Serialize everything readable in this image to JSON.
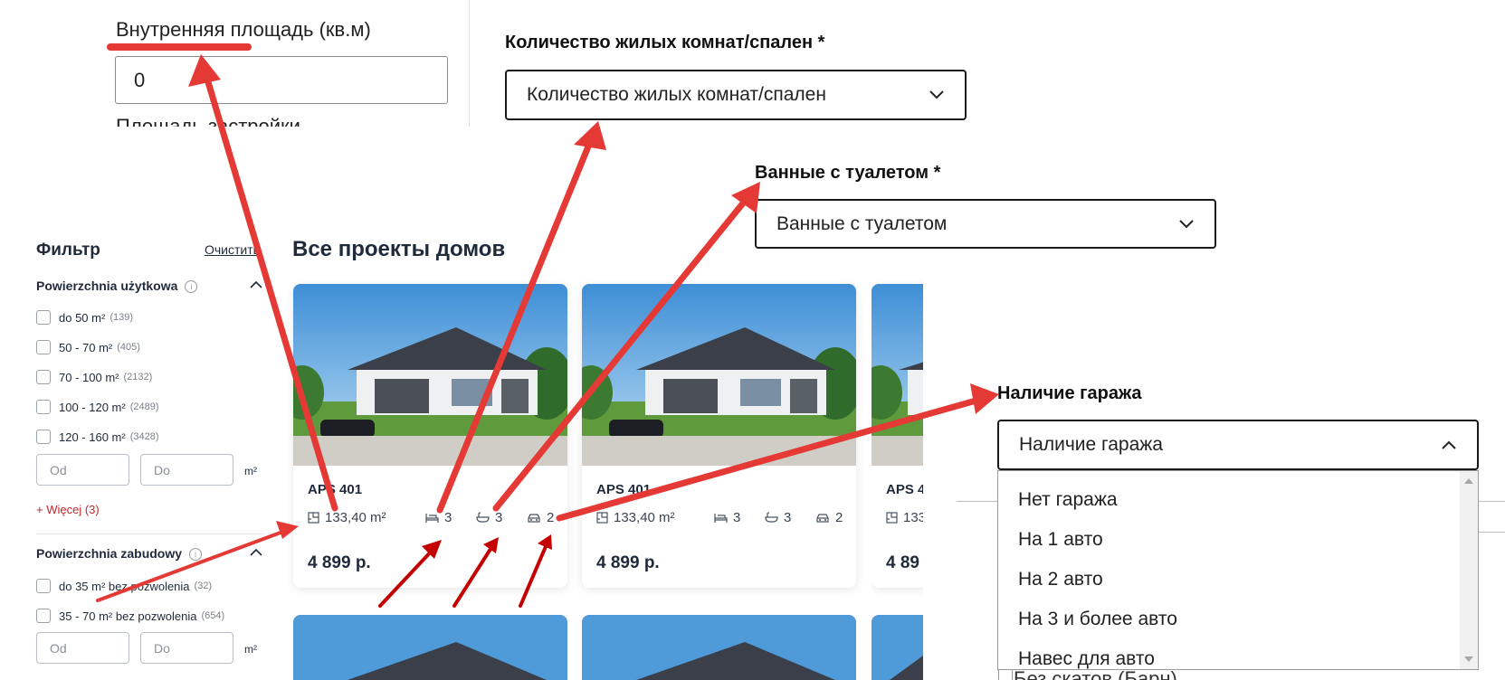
{
  "area_field": {
    "label": "Внутренняя площадь (кв.м)",
    "value": "0",
    "next_label_partial": "Площадь застройки"
  },
  "rooms": {
    "title": "Количество жилых комнат/спален *",
    "placeholder": "Количество жилых комнат/спален"
  },
  "bathrooms": {
    "title": "Ванные с туалетом *",
    "placeholder": "Ванные с туалетом"
  },
  "filter": {
    "title": "Фильтр",
    "clear": "Очистить",
    "usable_area": {
      "title": "Powierzchnia użytkowa",
      "options": [
        {
          "label": "do 50 m²",
          "count": "(139)"
        },
        {
          "label": "50 - 70 m²",
          "count": "(405)"
        },
        {
          "label": "70 - 100 m²",
          "count": "(2132)"
        },
        {
          "label": "100 - 120 m²",
          "count": "(2489)"
        },
        {
          "label": "120 - 160 m²",
          "count": "(3428)"
        }
      ],
      "from_placeholder": "Od",
      "to_placeholder": "Do",
      "unit": "m²",
      "more": "+ Więcej (3)"
    },
    "built_area": {
      "title": "Powierzchnia zabudowy",
      "options": [
        {
          "label": "do 35 m² bez pozwolenia",
          "count": "(32)"
        },
        {
          "label": "35 - 70 m² bez pozwolenia",
          "count": "(654)"
        }
      ],
      "from_placeholder": "Od",
      "to_placeholder": "Do",
      "unit": "m²"
    }
  },
  "projects": {
    "title": "Все проекты домов",
    "cards": [
      {
        "name": "APS 401",
        "area": "133,40 m²",
        "rooms": "3",
        "baths": "3",
        "garage": "2",
        "price": "4 899 р."
      },
      {
        "name": "APS 401",
        "area": "133,40 m²",
        "rooms": "3",
        "baths": "3",
        "garage": "2",
        "price": "4 899 р."
      },
      {
        "name": "APS 4",
        "area": "133",
        "price": "4 89"
      }
    ]
  },
  "garage": {
    "title": "Наличие гаража",
    "placeholder": "Наличие гаража",
    "options": [
      "Нет гаража",
      "На 1 авто",
      "На 2 авто",
      "На 3 и более авто",
      "Навес для авто"
    ],
    "behind_text_partial": "Без скатов (Барн)"
  },
  "colors": {
    "arrow_red": "#e53935",
    "arrow_dark_red": "#c40000",
    "more_link": "#c0272d",
    "text_dark": "#1f2a3a"
  }
}
